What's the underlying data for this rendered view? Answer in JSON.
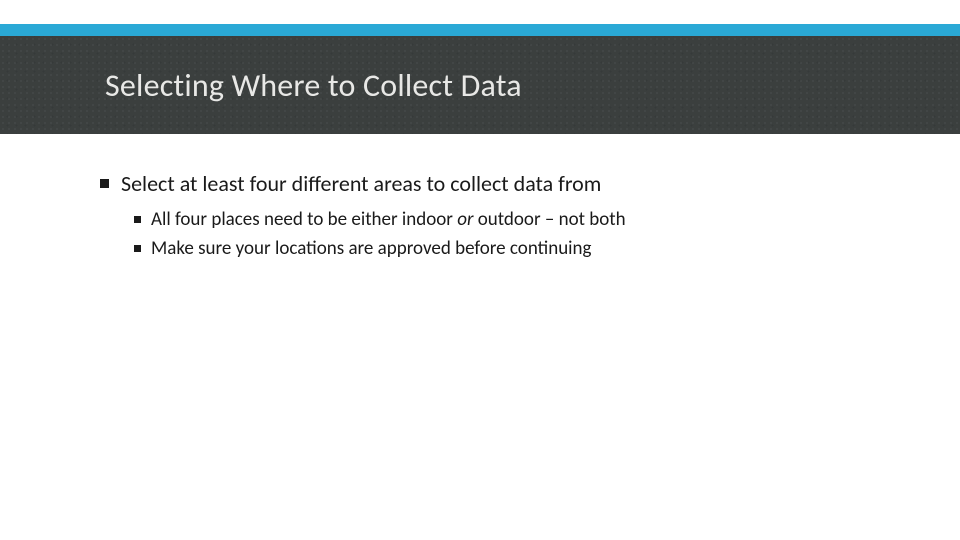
{
  "header": {
    "title": "Selecting Where to Collect Data"
  },
  "bullets": {
    "main": "Select at least four different areas to collect data from",
    "sub1_pre": "All four places need to be either indoor ",
    "sub1_em": "or",
    "sub1_post": " outdoor – not both",
    "sub2": "Make sure your locations are approved before continuing"
  }
}
